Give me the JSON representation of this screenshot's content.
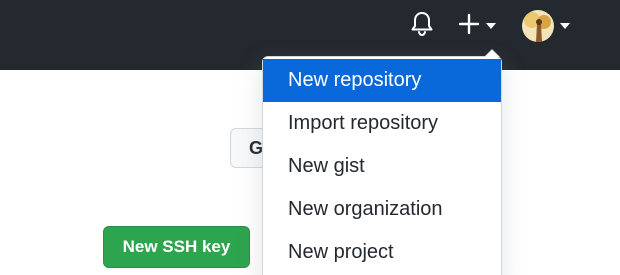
{
  "colors": {
    "header_bg": "#24292f",
    "menu_highlight": "#0969da",
    "primary_button": "#2da44e"
  },
  "header": {
    "icons": [
      "bell-icon",
      "plus-icon",
      "chevron-down-icon",
      "avatar"
    ]
  },
  "background": {
    "partial_button_label": "G",
    "ssh_button_label": "New SSH key"
  },
  "create_menu": {
    "items": [
      {
        "label": "New repository",
        "highlighted": true
      },
      {
        "label": "Import repository",
        "highlighted": false
      },
      {
        "label": "New gist",
        "highlighted": false
      },
      {
        "label": "New organization",
        "highlighted": false
      },
      {
        "label": "New project",
        "highlighted": false
      }
    ]
  }
}
